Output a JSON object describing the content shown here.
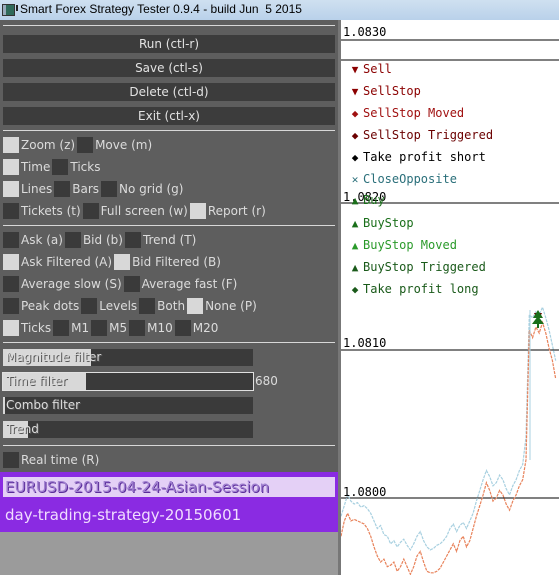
{
  "window": {
    "title": "Smart Forex Strategy Tester 0.9.4 - build Jun  5 2015"
  },
  "buttons": [
    {
      "label": "Run (ctl-r)"
    },
    {
      "label": "Save (ctl-s)"
    },
    {
      "label": "Delete (ctl-d)"
    },
    {
      "label": "Exit (ctl-x)"
    }
  ],
  "options": {
    "zoom": {
      "label": "Zoom (z)",
      "checked": true
    },
    "move": {
      "label": "Move (m)",
      "checked": false
    },
    "time": {
      "label": "Time",
      "checked": true
    },
    "ticks_axis": {
      "label": "Ticks",
      "checked": false
    },
    "lines": {
      "label": "Lines",
      "checked": true
    },
    "bars": {
      "label": "Bars",
      "checked": false
    },
    "no_grid": {
      "label": "No grid (g)",
      "checked": false
    },
    "tickets": {
      "label": "Tickets (t)",
      "checked": false
    },
    "full_screen": {
      "label": "Full screen (w)",
      "checked": false
    },
    "report": {
      "label": "Report (r)",
      "checked": true
    },
    "ask": {
      "label": "Ask (a)",
      "checked": false
    },
    "bid": {
      "label": "Bid (b)",
      "checked": false
    },
    "trend": {
      "label": "Trend (T)",
      "checked": false
    },
    "ask_filtered": {
      "label": "Ask Filtered (A)",
      "checked": true
    },
    "bid_filtered": {
      "label": "Bid Filtered (B)",
      "checked": true
    },
    "avg_slow": {
      "label": "Average slow (S)",
      "checked": false
    },
    "avg_fast": {
      "label": "Average fast (F)",
      "checked": false
    },
    "peak_dots": {
      "label": "Peak dots",
      "checked": false
    },
    "levels": {
      "label": "Levels",
      "checked": false
    },
    "both": {
      "label": "Both",
      "checked": false
    },
    "none": {
      "label": "None (P)",
      "checked": true
    },
    "ticks_tf": {
      "label": "Ticks",
      "checked": true
    },
    "m1": {
      "label": "M1",
      "checked": false
    },
    "m5": {
      "label": "M5",
      "checked": false
    },
    "m10": {
      "label": "M10",
      "checked": false
    },
    "m20": {
      "label": "M20",
      "checked": false
    },
    "real_time": {
      "label": "Real time (R)",
      "checked": false
    }
  },
  "sliders": [
    {
      "label": "Magnitude filter",
      "fraction": 0.35,
      "value": ""
    },
    {
      "label": "Time filter",
      "fraction": 0.33,
      "value": "680"
    },
    {
      "label": "Combo filter",
      "fraction": 0.0,
      "value": ""
    },
    {
      "label": "Trend",
      "fraction": 0.1,
      "value": ""
    }
  ],
  "lists": {
    "sessions": [
      {
        "label": "EURUSD-2015-04-24-Asian-Session",
        "selected": true
      },
      {
        "label": "day-trading-strategy-20150601",
        "selected": false
      }
    ]
  },
  "chart": {
    "y_labels": [
      "1.0830",
      "1.0820",
      "1.0810",
      "1.0800"
    ],
    "legend": [
      {
        "label": "Sell",
        "symbol": "triangle-down",
        "color": "#8b0000"
      },
      {
        "label": "SellStop",
        "symbol": "triangle-down-bar",
        "color": "#8b0000"
      },
      {
        "label": "SellStop Moved",
        "symbol": "diamond-triangle-down",
        "color": "#a01010"
      },
      {
        "label": "SellStop Triggered",
        "symbol": "diamond-small-triangle-down",
        "color": "#6b0000"
      },
      {
        "label": "Take profit short",
        "symbol": "diamond",
        "color": "#000000"
      },
      {
        "label": "CloseOpposite",
        "symbol": "x",
        "color": "#2a6f7a"
      },
      {
        "label": "Buy",
        "symbol": "triangle-up",
        "color": "#1a6f1a"
      },
      {
        "label": "BuyStop",
        "symbol": "triangle-up-bar",
        "color": "#1a6f1a"
      },
      {
        "label": "BuyStop Moved",
        "symbol": "triangle-up-diamond",
        "color": "#2a9a2a"
      },
      {
        "label": "BuyStop Triggered",
        "symbol": "triangle-up-diamond-small",
        "color": "#1a5a1a"
      },
      {
        "label": "Take profit long",
        "symbol": "diamond-triangle",
        "color": "#1a5a1a"
      }
    ],
    "colors": {
      "ask": "#a8d0e0",
      "bid": "#e8825a"
    },
    "ask_series": [
      1.07988,
      1.07995,
      1.08002,
      1.07998,
      1.07996,
      1.07997,
      1.07994,
      1.07995,
      1.07993,
      1.0799,
      1.07985,
      1.0798,
      1.07982,
      1.07976,
      1.07975,
      1.0797,
      1.07972,
      1.07968,
      1.07971,
      1.07973,
      1.07969,
      1.07966,
      1.0797,
      1.07975,
      1.07978,
      1.07972,
      1.07968,
      1.07966,
      1.07967,
      1.07969,
      1.0797,
      1.07972,
      1.07975,
      1.0798,
      1.07983,
      1.07978,
      1.07982,
      1.07984,
      1.0798,
      1.07985,
      1.0799,
      1.07998,
      1.08005,
      1.08012,
      1.08018,
      1.08014,
      1.08008,
      1.0801,
      1.08015,
      1.08012,
      1.08006,
      1.08002,
      1.08008,
      1.08012,
      1.08018,
      1.08022,
      1.0804,
      1.0812,
      1.08118,
      1.08122,
      1.0812,
      1.08125,
      1.08118,
      1.0811,
      1.081,
      1.0809
    ],
    "bid_series": [
      1.07975,
      1.07985,
      1.0799,
      1.07985,
      1.07986,
      1.07985,
      1.07984,
      1.07983,
      1.0798,
      1.07975,
      1.07968,
      1.07962,
      1.07958,
      1.0796,
      1.07955,
      1.07956,
      1.07958,
      1.07952,
      1.07955,
      1.0796,
      1.07955,
      1.0795,
      1.07955,
      1.07962,
      1.07965,
      1.07958,
      1.07952,
      1.07951,
      1.07951,
      1.07952,
      1.07954,
      1.07958,
      1.07962,
      1.07966,
      1.0797,
      1.07965,
      1.07972,
      1.07975,
      1.07968,
      1.07972,
      1.0798,
      1.07988,
      1.07995,
      1.08002,
      1.0801,
      1.08005,
      1.07998,
      1.08,
      1.08005,
      1.08002,
      1.07996,
      1.07992,
      1.07998,
      1.08002,
      1.08008,
      1.08012,
      1.08025,
      1.0811,
      1.08105,
      1.08112,
      1.08108,
      1.08115,
      1.08108,
      1.08098,
      1.0809,
      1.08078
    ],
    "y_range": [
      1.0794,
      1.0832
    ]
  }
}
